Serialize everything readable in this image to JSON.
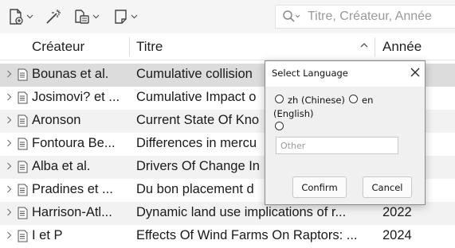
{
  "search": {
    "placeholder": "Titre, Créateur, Année"
  },
  "columns": {
    "creator": "Créateur",
    "title": "Titre",
    "year": "Année"
  },
  "rows": [
    {
      "creator": "Bounas et al.",
      "title": "Cumulative collision",
      "year": ""
    },
    {
      "creator": "Josimovi? et ...",
      "title": "Cumulative Impact o",
      "year": ""
    },
    {
      "creator": "Aronson",
      "title": "Current State Of Kno",
      "year": ""
    },
    {
      "creator": "Fontoura Be...",
      "title": "Differences in mercu",
      "year": ""
    },
    {
      "creator": "Alba et al.",
      "title": "Drivers Of Change In",
      "year": ""
    },
    {
      "creator": "Pradines et ...",
      "title": "Du bon placement d",
      "year": ""
    },
    {
      "creator": "Harrison-Atl...",
      "title": "Dynamic land use implications of r...",
      "year": "2022"
    },
    {
      "creator": "I et P",
      "title": "Effects Of Wind Farms On Raptors: ...",
      "year": "2024"
    }
  ],
  "dialog": {
    "title": "Select Language",
    "option_zh": "zh (Chinese)",
    "option_en": "en",
    "option_en_cont": "(English)",
    "other_placeholder": "Other",
    "confirm": "Confirm",
    "cancel": "Cancel"
  }
}
